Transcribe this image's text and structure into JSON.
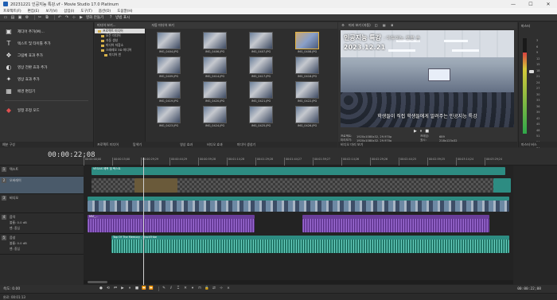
{
  "window": {
    "title": "20231221 인공지능 특강.vf - Movie Studio 17.0 Platinum",
    "controls": [
      "—",
      "☐",
      "✕"
    ]
  },
  "menu": [
    "프로젝트(F)",
    "편집(E)",
    "보기(V)",
    "삽입(I)",
    "도구(T)",
    "옵션(O)",
    "도움말(H)"
  ],
  "toolbar": {
    "make_movie": "영화 만들기",
    "show_me": "방법 표시"
  },
  "left_panel": {
    "items": [
      "제디어 추가(M)...",
      "텍스트 및 타이틀 추가",
      "그림체 효과 추가",
      "영상 전환 효과 추가",
      "영상 효과 추가",
      "배경 편집기",
      "일정 조정 모드"
    ],
    "tabs": [
      "예분 구성",
      "프로젝트 미디어",
      "탐색기"
    ]
  },
  "media": {
    "toolbar": [
      "미디어 보기...",
      "자동 미디어 보기"
    ],
    "tree": [
      "프로젝트 미디어",
      "모든 미디어",
      "자동 생성",
      "미디어 저장소",
      "스테레오 3D 미디어",
      "미디어 빈"
    ],
    "thumbs": [
      "IMG_0404.JPG",
      "IMG_0406.JPG",
      "IMG_0407.JPG",
      "IMG_0408.JPG",
      "IMG_0409.JPG",
      "IMG_0414.JPG",
      "IMG_0417.JPG",
      "IMG_0418.JPG",
      "IMG_0419.JPG",
      "IMG_0420.JPG",
      "IMG_0421.JPG",
      "IMG_0422.JPG",
      "IMG_0423.JPG",
      "IMG_0424.JPG",
      "IMG_0425.JPG",
      "IMG_0426.JPG"
    ],
    "selected_index": 3,
    "bottom_tabs": [
      "영상 효과",
      "비디오 효과",
      "미디어 생성기"
    ]
  },
  "preview": {
    "toolbar": [
      "미리 보기 (자동)"
    ],
    "title_main": "인공지능 특강",
    "title_sub": ": 아두이노 로봇 손",
    "date": "2023.12.21",
    "caption": "학생들이 직접 학생들에게 알려주는 인공지능 특강",
    "transport": [
      "▶",
      "⏸",
      "■",
      "⏹"
    ],
    "info": [
      {
        "k": "프로젝트:",
        "v": "1920x1080x32, 29.970p",
        "k2": "프레임:",
        "v2": "689"
      },
      {
        "k": "미리보기:",
        "v": "1920x1080x32, 29.970p",
        "k2": "표시:",
        "v2": "218x123x32"
      },
      {
        "k": "비디오 출력:",
        "v": "1920x1080x32, 29.970p",
        "k2": "미디어 출력:",
        "v2": "1920x1080x32"
      }
    ],
    "bottom_tabs": [
      "비디오 미리 보기"
    ]
  },
  "master": {
    "title": "마스터",
    "scale": [
      "3",
      "6",
      "9",
      "12",
      "15",
      "18",
      "21",
      "24",
      "27",
      "30",
      "33",
      "36",
      "39",
      "42",
      "45",
      "48",
      "51",
      "54",
      "57"
    ],
    "level": 0.85,
    "bottom": "마스터 버스"
  },
  "timeline": {
    "timecode": "00:00:22;08",
    "ruler": [
      "00:00:00;00",
      "00:00:15;00",
      "00:00:29;29",
      "00:00:44;29",
      "00:00:59;28",
      "00:01:14;28",
      "00:01:29;28",
      "00:01:44;27",
      "00:01:59;27",
      "00:02:14;26",
      "00:02:29;26",
      "00:02:44;25",
      "00:02:59;25",
      "00:03:14;24",
      "00:03:29;24"
    ],
    "tracks": [
      {
        "num": "1",
        "name": "텍스트",
        "clip": "VEGAS 제목 및 텍스트"
      },
      {
        "num": "2",
        "name": "오버레이",
        "clip": ""
      },
      {
        "num": "3",
        "name": "비디오",
        "clip": ""
      },
      {
        "num": "4",
        "name": "음악",
        "vol_label": "볼륨:",
        "vol": "0.0 dB",
        "pan_label": "팬:",
        "pan": "중심",
        "clip": "MVI_..."
      },
      {
        "num": "5",
        "name": "음성",
        "vol_label": "볼륨:",
        "vol": "0.0 dB",
        "pan_label": "팬:",
        "pan": "중심",
        "clip": "Top Of The Memory - TrackTribe"
      }
    ],
    "rate": "속도: 0.00",
    "bottom_time": "00:00:22;08",
    "status": "완료: 00:01:13"
  },
  "colors": {
    "accent_teal": "#2d8c82",
    "accent_purple": "#6a3e9a"
  }
}
